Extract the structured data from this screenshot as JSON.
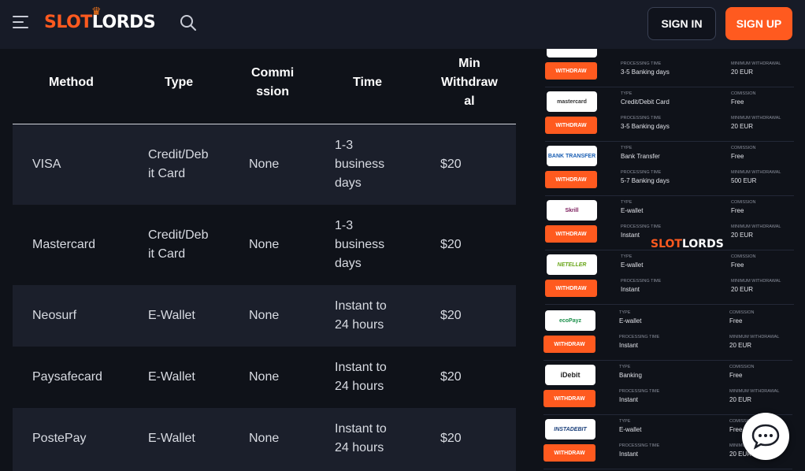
{
  "header": {
    "logo_slot": "SLOT",
    "logo_lords": "LORDS",
    "signin_label": "SIGN IN",
    "signup_label": "SIGN UP"
  },
  "colors": {
    "accent": "#ff5a1f",
    "background": "#0f1219",
    "row_alt": "#1b1f2b"
  },
  "table": {
    "headers": [
      "Method",
      "Type",
      "Commi ssion",
      "Time",
      "Min Withdraw al"
    ],
    "header_lines": {
      "method": [
        "Method"
      ],
      "type": [
        "Type"
      ],
      "commission": [
        "Commi",
        "ssion"
      ],
      "time": [
        "Time"
      ],
      "min": [
        "Min",
        "Withdraw",
        "al"
      ]
    },
    "rows": [
      {
        "method": "VISA",
        "type": [
          "Credit/Deb",
          "it Card"
        ],
        "commission": "None",
        "time": [
          "1-3",
          "business",
          "days"
        ],
        "min": "$20"
      },
      {
        "method": "Mastercard",
        "type": [
          "Credit/Deb",
          "it Card"
        ],
        "commission": "None",
        "time": [
          "1-3",
          "business",
          "days"
        ],
        "min": "$20"
      },
      {
        "method": "Neosurf",
        "type": [
          "E-Wallet"
        ],
        "commission": "None",
        "time": [
          "Instant to",
          "24 hours"
        ],
        "min": "$20"
      },
      {
        "method": "Paysafecard",
        "type": [
          "E-Wallet"
        ],
        "commission": "None",
        "time": [
          "Instant to",
          "24 hours"
        ],
        "min": "$20"
      },
      {
        "method": "PostePay",
        "type": [
          "E-Wallet"
        ],
        "commission": "None",
        "time": [
          "Instant to",
          "24 hours"
        ],
        "min": "$20"
      }
    ]
  },
  "image_panel": {
    "labels": {
      "type": "TYPE",
      "commission": "COMISSION",
      "processing": "PROCESSING TIME",
      "min": "MINIMUM WITHDRAWAL"
    },
    "withdraw_label": "WITHDRAW",
    "watermark_slot": "SLOT",
    "watermark_lords": "LORDS",
    "items": [
      {
        "logo": "",
        "type": "",
        "commission": "",
        "processing": "3-5 Banking days",
        "min": "20 EUR"
      },
      {
        "logo": "mastercard",
        "type": "Credit/Debit Card",
        "commission": "Free",
        "processing": "3-5 Banking days",
        "min": "20 EUR"
      },
      {
        "logo": "BANK TRANSFER",
        "type": "Bank Transfer",
        "commission": "Free",
        "processing": "5-7 Banking days",
        "min": "500 EUR"
      },
      {
        "logo": "Skrill",
        "type": "E-wallet",
        "commission": "Free",
        "processing": "Instant",
        "min": "20 EUR"
      },
      {
        "logo": "NETELLER",
        "type": "E-wallet",
        "commission": "Free",
        "processing": "Instant",
        "min": "20 EUR"
      },
      {
        "logo": "ecoPayz",
        "type": "E-wallet",
        "commission": "Free",
        "processing": "Instant",
        "min": "20 EUR"
      },
      {
        "logo": "iDebit",
        "type": "Banking",
        "commission": "Free",
        "processing": "Instant",
        "min": "20 EUR"
      },
      {
        "logo": "INSTADEBIT",
        "type": "E-wallet",
        "commission": "Free",
        "processing": "Instant",
        "min": "20 EUR"
      }
    ]
  }
}
